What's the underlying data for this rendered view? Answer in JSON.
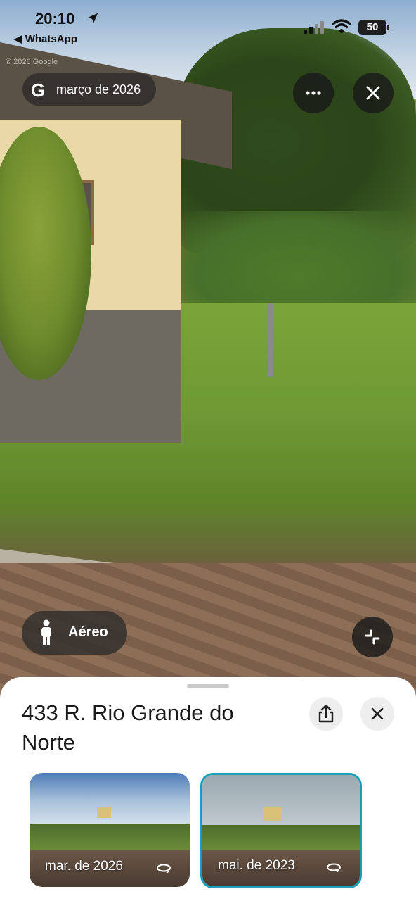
{
  "status_bar": {
    "time": "20:10",
    "back_app": "◀ WhatsApp",
    "battery": "50"
  },
  "street_view": {
    "date_pill": "março de 2026",
    "watermark": "© 2026 Google",
    "mode_button": "Aéreo"
  },
  "sheet": {
    "address": "433 R. Rio Grande do Norte",
    "thumbnails": [
      {
        "label": "mar. de 2026",
        "selected": false
      },
      {
        "label": "mai. de 2023",
        "selected": true
      }
    ]
  },
  "colors": {
    "selected_border": "#1aa0b8",
    "overlay": "#282828"
  }
}
